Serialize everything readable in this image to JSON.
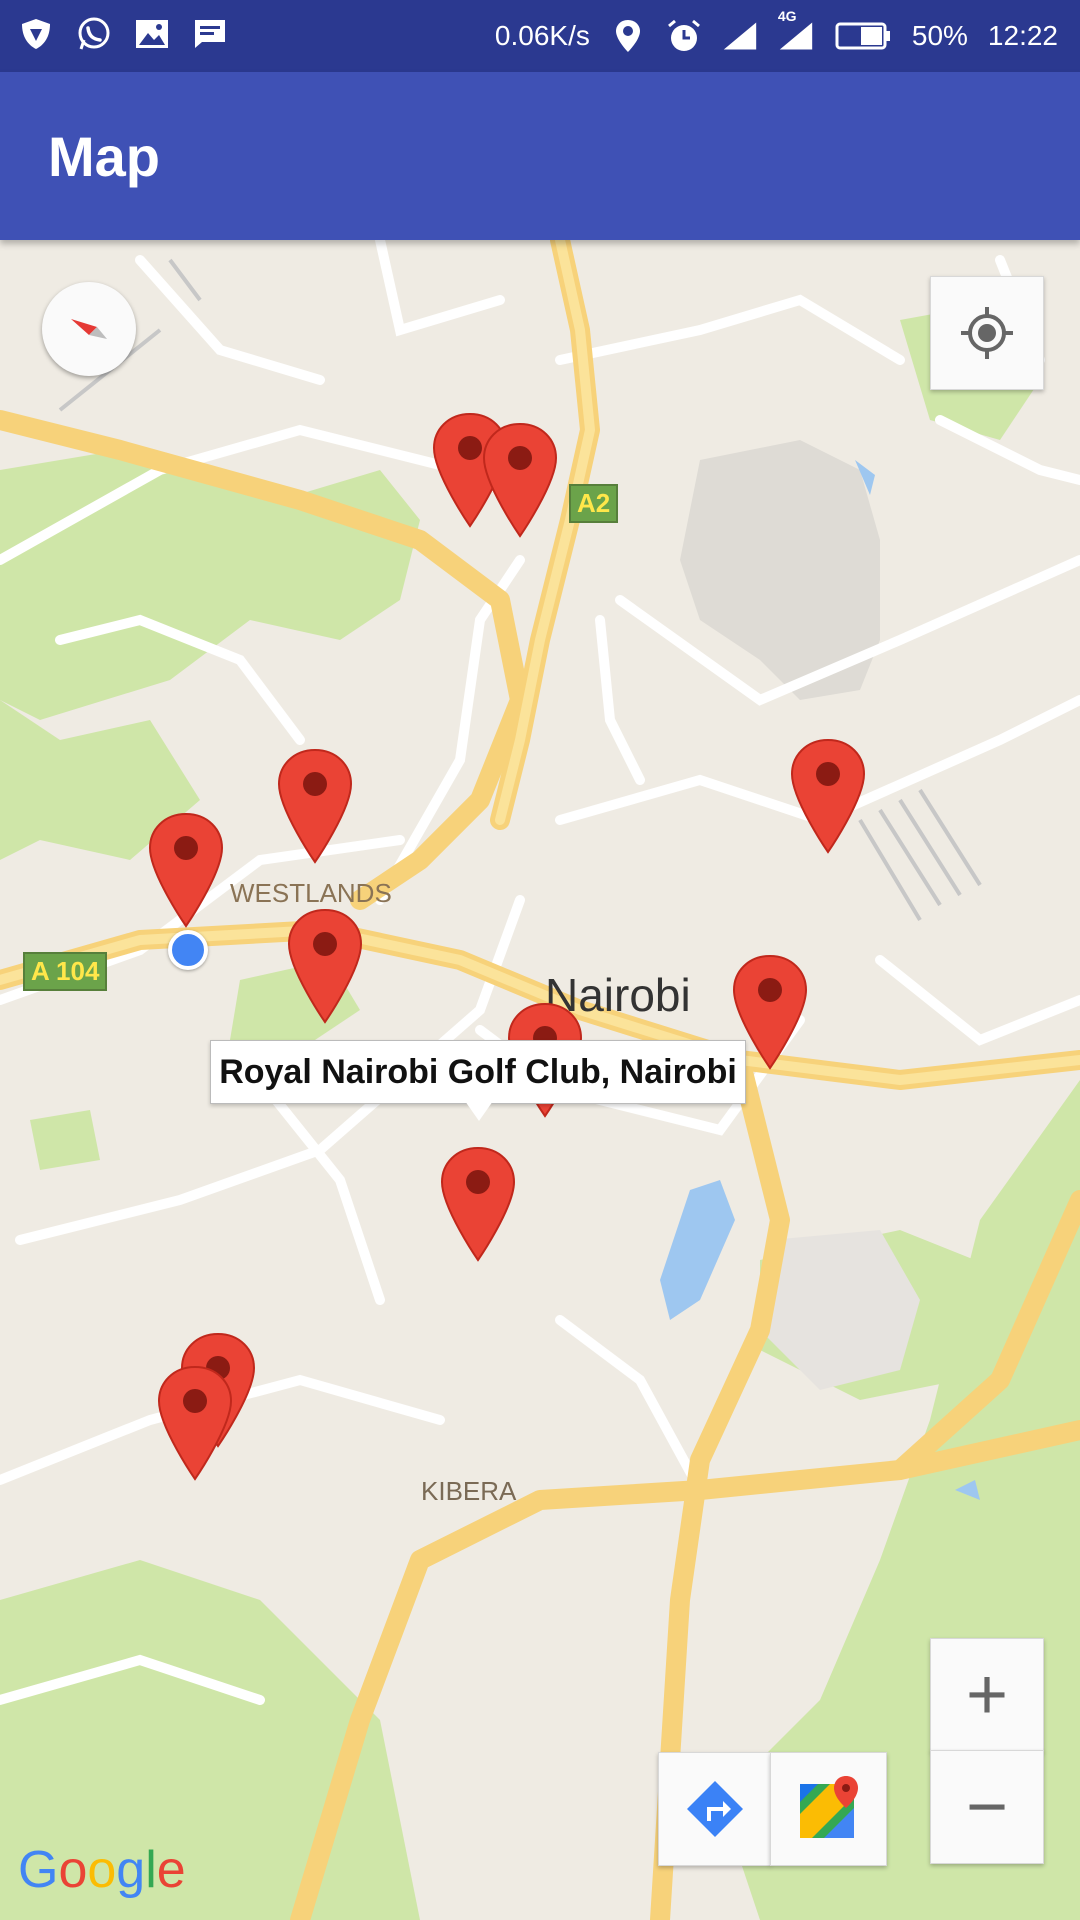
{
  "status_bar": {
    "network_speed": "0.06K/s",
    "network_type": "4G",
    "battery": "50%",
    "time": "12:22",
    "icons_left": [
      "shield-icon",
      "whatsapp-icon",
      "gallery-icon",
      "message-icon"
    ],
    "icons_right": [
      "location-icon",
      "alarm-icon",
      "signal-icon",
      "signal-4g-icon",
      "battery-icon"
    ]
  },
  "app_bar": {
    "title": "Map"
  },
  "map": {
    "labels": {
      "westlands": "WESTLANDS",
      "nairobi": "Nairobi",
      "kibera": "KIBERA"
    },
    "road_shields": {
      "a2": "A2",
      "a104": "A 104"
    },
    "info_window": "Royal Nairobi Golf Club, Nairobi",
    "attribution": {
      "letters": [
        "G",
        "o",
        "o",
        "g",
        "l",
        "e"
      ]
    },
    "colors": {
      "marker": "#ea4335",
      "marker_dot": "#8b1b13",
      "land": "#efebe3",
      "park": "#cfe6a8",
      "major_road": "#fbd776",
      "water": "#9ec7f0",
      "my_location": "#4285f4"
    },
    "marker_count": 11
  },
  "controls": {
    "zoom_in": "+",
    "zoom_out": "−"
  }
}
